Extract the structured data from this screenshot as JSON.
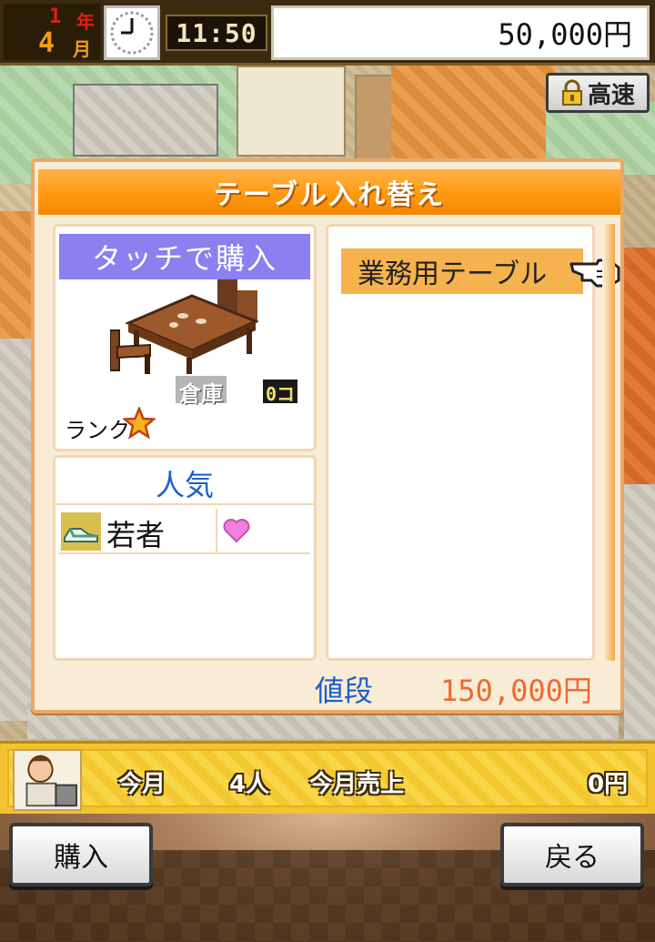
{
  "status_bar": {
    "year_num": "1",
    "year_unit": "年",
    "month_num": "4",
    "month_unit": "月",
    "time": "11:50",
    "money": "50,000円"
  },
  "speed_button": {
    "label": "高速",
    "icon": "lock-icon"
  },
  "dialog": {
    "title": "テーブル入れ替え",
    "touch_label": "タッチで購入",
    "storage_label": "倉庫",
    "storage_count": "0コ",
    "rank_label": "ランク",
    "rank_icon": "star-icon",
    "popularity_title": "人気",
    "popularity_rows": [
      {
        "label": "若者",
        "icon": "sneaker-icon",
        "rating_icon": "heart-icon"
      }
    ],
    "list_items": [
      {
        "label": "業務用テーブル",
        "selected": true
      }
    ],
    "price_label": "値段",
    "price_value": "150,000円"
  },
  "sales_bar": {
    "this_month_label": "今月",
    "customers": "4人",
    "sales_label": "今月売上",
    "sales_value": "0円"
  },
  "buttons": {
    "buy": "購入",
    "back": "戻る"
  },
  "colors": {
    "title_orange": "#ff9a10",
    "touch_purple": "#8c7ff0",
    "price_blue": "#1e5fc8",
    "price_orange": "#ee6a30",
    "selection": "#f6b24e"
  }
}
